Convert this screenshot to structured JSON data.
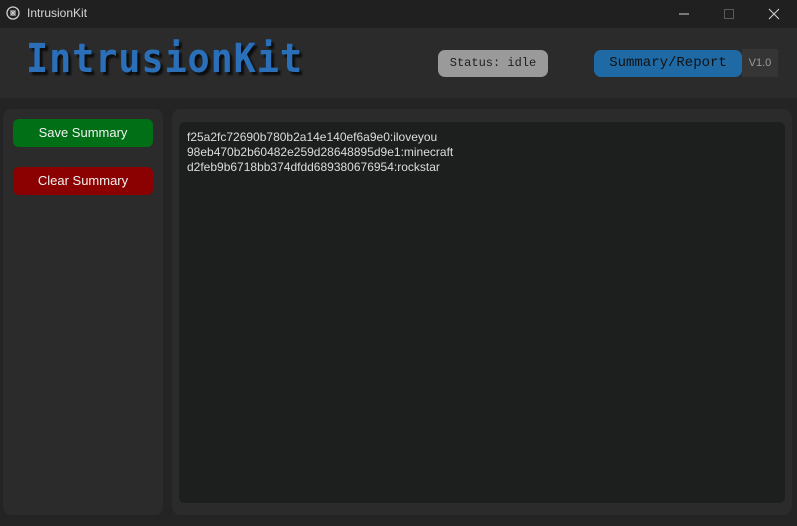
{
  "window": {
    "title": "IntrusionKit",
    "controls": {
      "minimize_icon": "minimize-icon",
      "maximize_icon": "maximize-icon",
      "close_icon": "close-icon"
    }
  },
  "header": {
    "logo_text": "IntrusionKit",
    "status_text": "Status: idle",
    "report_tab_label": "Summary/Report",
    "version": "V1.0"
  },
  "sidebar": {
    "save_label": "Save Summary",
    "clear_label": "Clear Summary"
  },
  "summary": {
    "lines": [
      "f25a2fc72690b780b2a14e140ef6a9e0:iloveyou",
      "98eb470b2b60482e259d28648895d9e1:minecraft",
      "d2feb9b6718bb374dfdd689380676954:rockstar"
    ]
  },
  "colors": {
    "accent": "#1f6aa5",
    "save_button": "#006f16",
    "clear_button": "#8b0000",
    "status_pill": "#9a9a9a",
    "logo": "#2a6fb8"
  }
}
